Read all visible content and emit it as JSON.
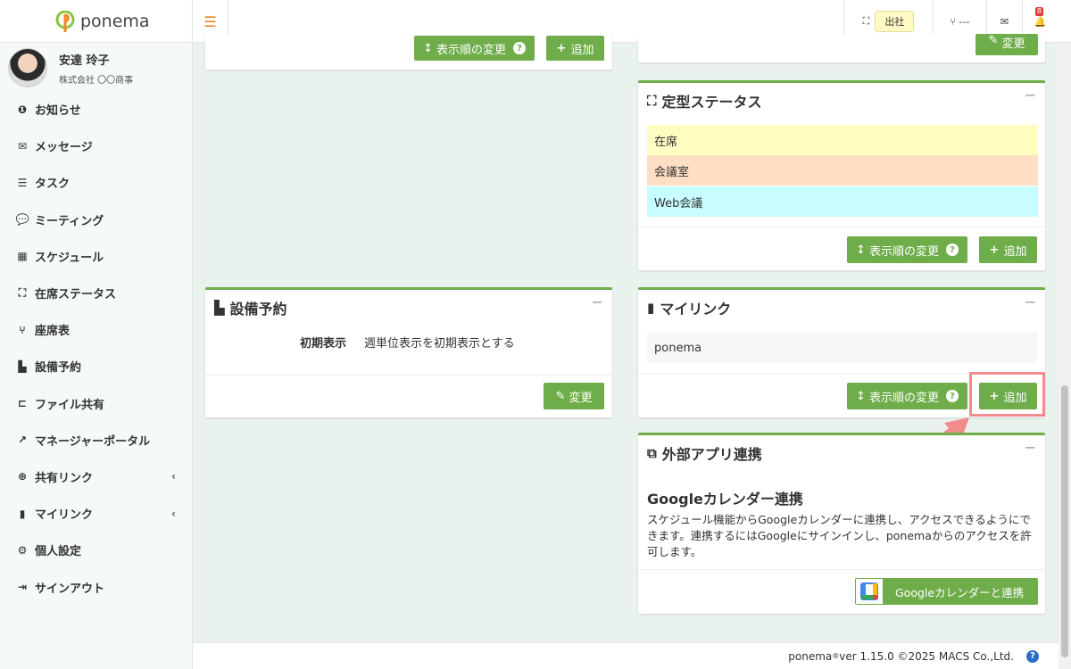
{
  "brand": {
    "name": "ponema"
  },
  "user": {
    "name": "安達 玲子",
    "company": "株式会社 〇〇商事"
  },
  "sidebar": {
    "items": [
      {
        "label": "お知らせ",
        "icon": "info-icon"
      },
      {
        "label": "メッセージ",
        "icon": "envelope-icon"
      },
      {
        "label": "タスク",
        "icon": "task-list-icon"
      },
      {
        "label": "ミーティング",
        "icon": "chat-icon"
      },
      {
        "label": "スケジュール",
        "icon": "calendar-icon"
      },
      {
        "label": "在席ステータス",
        "icon": "presence-icon"
      },
      {
        "label": "座席表",
        "icon": "chair-icon"
      },
      {
        "label": "設備予約",
        "icon": "door-icon"
      },
      {
        "label": "ファイル共有",
        "icon": "folder-icon"
      },
      {
        "label": "マネージャーポータル",
        "icon": "chart-icon"
      },
      {
        "label": "共有リンク",
        "icon": "globe-icon"
      },
      {
        "label": "マイリンク",
        "icon": "bookmark-icon"
      },
      {
        "label": "個人設定",
        "icon": "gear-icon"
      },
      {
        "label": "サインアウト",
        "icon": "sign-out-icon"
      }
    ]
  },
  "header": {
    "status_label": "出社",
    "seat_label": "---"
  },
  "common": {
    "reorder_label": "表示順の変更",
    "add_label": "追加",
    "change_label": "変更",
    "help_glyph": "?"
  },
  "status_panel": {
    "title": "定型ステータス",
    "rows": [
      {
        "label": "在席",
        "color": "#fffdc2"
      },
      {
        "label": "会議室",
        "color": "#ffdfc4"
      },
      {
        "label": "Web会議",
        "color": "#c8feff"
      }
    ]
  },
  "equipment_panel": {
    "title": "設備予約",
    "field_label": "初期表示",
    "field_value": "週単位表示を初期表示とする"
  },
  "mylink_panel": {
    "title": "マイリンク",
    "links": [
      "ponema"
    ]
  },
  "external_panel": {
    "title": "外部アプリ連携",
    "subtitle": "Googleカレンダー連携",
    "description": "スケジュール機能からGoogleカレンダーに連携し、アクセスできるようにできます。連携するにはGoogleにサインインし、ponemaからのアクセスを許可します。",
    "button_label": "Googleカレンダーと連携"
  },
  "footer": {
    "brand": "ponema",
    "registered": "®",
    "version_text": " ver 1.15.0 ©2025 MACS Co.,Ltd."
  },
  "notifications": {
    "count": "8"
  },
  "colors": {
    "accent": "#6fad4a",
    "highlight": "#f28b8b"
  }
}
